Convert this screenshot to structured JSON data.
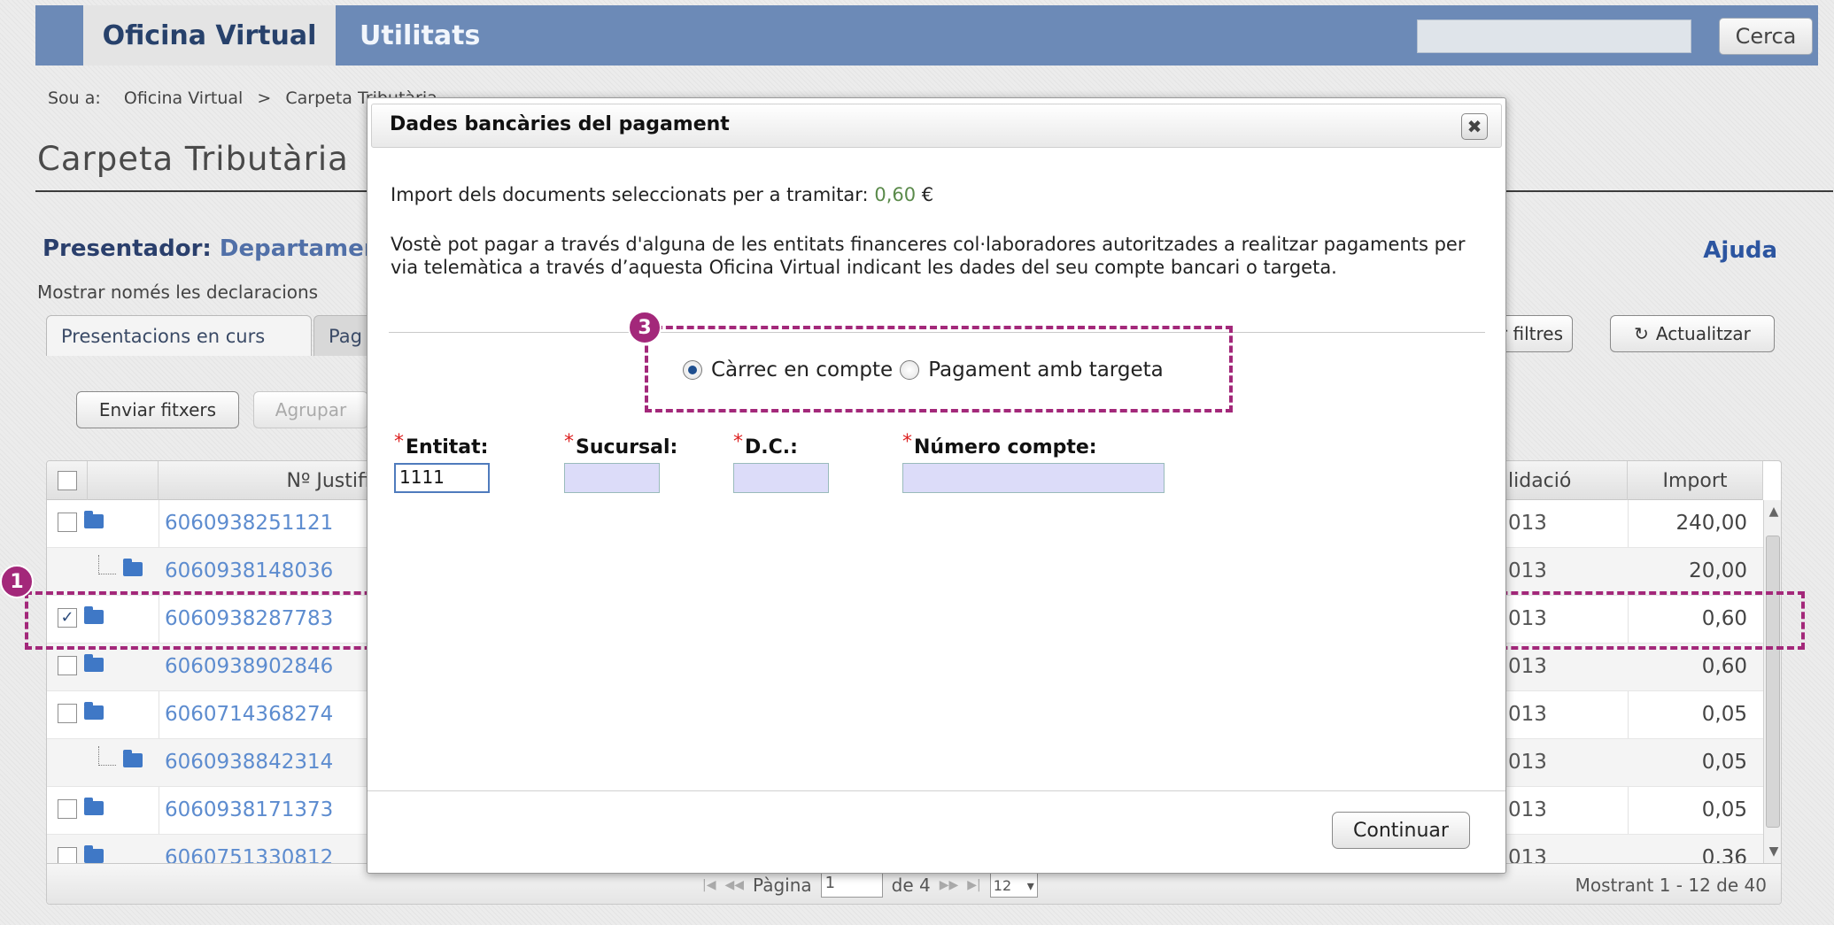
{
  "topbar": {
    "tab_active": "Oficina Virtual",
    "tab_utilitats": "Utilitats",
    "search_button": "Cerca"
  },
  "breadcrumb": {
    "prefix": "Sou a:",
    "items": [
      "Oficina Virtual",
      "Carpeta Tributària"
    ]
  },
  "page": {
    "title": "Carpeta Tributària",
    "presentador_label": "Presentador:",
    "presentador_value": "Departament",
    "ajuda": "Ajuda",
    "mostrar": "Mostrar només les declaracions"
  },
  "tabs": [
    "Presentacions en curs",
    "Pag"
  ],
  "toolbar": {
    "enviar": "Enviar fitxers",
    "agrupar": "Agrupar",
    "filtres": "r filtres",
    "actualitzar": "Actualitzar"
  },
  "grid": {
    "headers": {
      "justificant": "Nº Justificant",
      "validacio": "lidació",
      "import": "Import"
    },
    "rows": [
      {
        "num": "6060938251121",
        "date": "013",
        "import": "240,00",
        "checked": "",
        "child": false
      },
      {
        "num": "6060938148036",
        "date": "013",
        "import": "20,00",
        "checked": "",
        "child": true
      },
      {
        "num": "6060938287783",
        "date": "013",
        "import": "0,60",
        "checked": "✓",
        "child": false
      },
      {
        "num": "6060938902846",
        "date": "013",
        "import": "0,60",
        "checked": "",
        "child": false
      },
      {
        "num": "6060714368274",
        "date": "013",
        "import": "0,05",
        "checked": "",
        "child": false
      },
      {
        "num": "6060938842314",
        "date": "013",
        "import": "0,05",
        "checked": "",
        "child": true
      },
      {
        "num": "6060938171373",
        "date": "013",
        "import": "0,05",
        "checked": "",
        "child": false
      },
      {
        "num": "6060751330812",
        "date": "013",
        "import": "0,36",
        "checked": "",
        "child": false
      }
    ],
    "footer": {
      "pagina": "Pàgina",
      "page_value": "1",
      "de": "de 4",
      "per_page": "12",
      "mostrant": "Mostrant 1 - 12 de 40"
    }
  },
  "modal": {
    "title": "Dades bancàries del pagament",
    "close_icon": "close-icon",
    "import_label": "Import dels documents seleccionats per a tramitar:",
    "import_value": "0,60",
    "currency": "€",
    "description": "Vostè pot pagar a través d'alguna de les entitats financeres col·laboradores autoritzades a realitzar pagaments per via telemàtica a través d’aquesta Oficina Virtual indicant les dades del seu compte bancari o targeta.",
    "payment_options": [
      {
        "label": "Càrrec en compte",
        "selected": true
      },
      {
        "label": "Pagament amb targeta",
        "selected": false
      }
    ],
    "fields": {
      "entitat": {
        "label": "Entitat:",
        "value": "1111"
      },
      "sucursal": {
        "label": "Sucursal:",
        "value": ""
      },
      "dc": {
        "label": "D.C.:",
        "value": ""
      },
      "compte": {
        "label": "Número compte:",
        "value": ""
      }
    },
    "required_mark": "*",
    "continue_button": "Continuar"
  },
  "annotations": {
    "marker_1": "1",
    "marker_3": "3",
    "color": "#a3287a"
  },
  "colors": {
    "topbar": "#6c8ab7",
    "link": "#5d8ccf",
    "title_dark": "#2a3f6c"
  }
}
